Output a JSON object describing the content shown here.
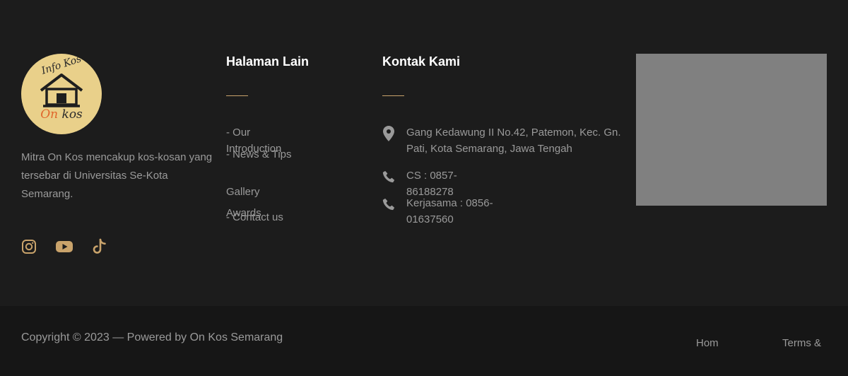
{
  "brand": {
    "logo_text_top": "Info Kos",
    "logo_text_on": "On",
    "logo_text_kos": " kos",
    "description": "Mitra On Kos mencakup kos-kosan yang tersebar di Universitas Se-Kota Semarang."
  },
  "socials": [
    {
      "icon": "instagram-icon"
    },
    {
      "icon": "youtube-icon"
    },
    {
      "icon": "tiktok-icon"
    }
  ],
  "colors": {
    "background": "#1c1c1c",
    "bottom_background": "#161616",
    "accent": "#c9a36b",
    "heading": "#ffffff",
    "text": "#9a9a9a",
    "map_placeholder": "#808080"
  },
  "pages": {
    "title": "Halaman Lain",
    "links": [
      {
        "label": "- Our Introduction"
      },
      {
        "label": "- News & Tips"
      },
      {
        "label": "Gallery"
      },
      {
        "label": "Awards"
      },
      {
        "label": "- Contact us"
      }
    ]
  },
  "contact": {
    "title": "Kontak Kami",
    "address": "Gang Kedawung II No.42, Patemon, Kec. Gn. Pati, Kota Semarang, Jawa Tengah",
    "cs": "CS : 0857-86188278",
    "partnership": "Kerjasama : 0856-01637560"
  },
  "footer_bottom": {
    "copyright": "Copyright © 2023 — Powered by On Kos Semarang",
    "links": [
      {
        "label": "Hom"
      },
      {
        "label": "Terms &"
      }
    ]
  }
}
